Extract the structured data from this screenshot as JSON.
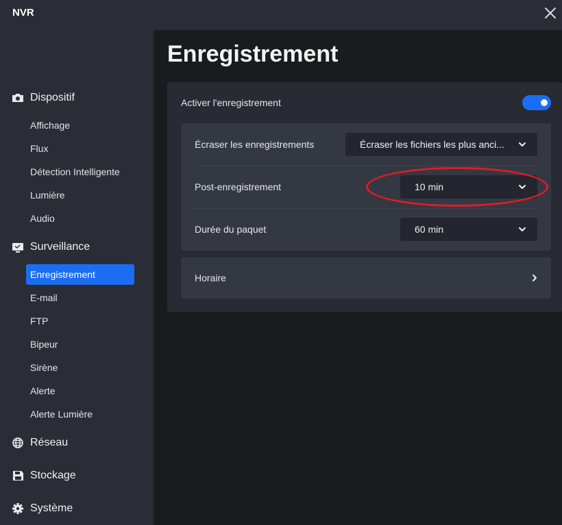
{
  "app": {
    "title": "NVR"
  },
  "page": {
    "title": "Enregistrement"
  },
  "sidebar": {
    "sections": [
      {
        "label": "Dispositif",
        "icon": "camera-icon",
        "items": [
          "Affichage",
          "Flux",
          "Détection Intelligente",
          "Lumière",
          "Audio"
        ]
      },
      {
        "label": "Surveillance",
        "icon": "monitor-icon",
        "items": [
          "Enregistrement",
          "E-mail",
          "FTP",
          "Bipeur",
          "Sirène",
          "Alerte",
          "Alerte Lumière"
        ]
      },
      {
        "label": "Réseau",
        "icon": "globe-icon",
        "items": []
      },
      {
        "label": "Stockage",
        "icon": "floppy-disk-icon",
        "items": []
      },
      {
        "label": "Système",
        "icon": "gear-icon",
        "items": []
      }
    ],
    "active_item": "Enregistrement"
  },
  "settings": {
    "enable_recording": {
      "label": "Activer l'enregistrement",
      "on": true
    },
    "overwrite": {
      "label": "Écraser les enregistrements",
      "value": "Écraser les fichiers les plus anci..."
    },
    "post_record": {
      "label": "Post-enregistrement",
      "value": "10 min"
    },
    "pack_duration": {
      "label": "Durée du paquet",
      "value": "60 min"
    },
    "schedule": {
      "label": "Horaire"
    }
  },
  "colors": {
    "accent": "#1b6ef3",
    "annotation": "#e01c24",
    "sidebar_bg": "#2a2d35",
    "content_bg": "#1a1b1f"
  }
}
